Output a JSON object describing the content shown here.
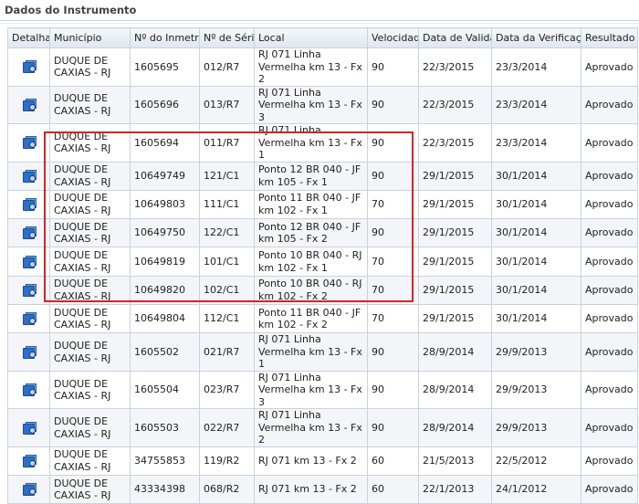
{
  "panel": {
    "title": "Dados do Instrumento"
  },
  "table": {
    "columns": [
      "Detalhar",
      "Município",
      "Nº do Inmetro",
      "Nº de Série",
      "Local",
      "Velocidade",
      "Data de Validade",
      "Data da Verificação",
      "Resultado"
    ],
    "rows": [
      {
        "municipio": "DUQUE DE CAXIAS - RJ",
        "inmetro": "1605695",
        "serie": "012/R7",
        "local": "RJ 071 Linha Vermelha km 13 - Fx 2",
        "velocidade": "90",
        "validade": "22/3/2015",
        "verificacao": "23/3/2014",
        "resultado": "Aprovado"
      },
      {
        "municipio": "DUQUE DE CAXIAS - RJ",
        "inmetro": "1605696",
        "serie": "013/R7",
        "local": "RJ 071 Linha Vermelha km 13 - Fx 3",
        "velocidade": "90",
        "validade": "22/3/2015",
        "verificacao": "23/3/2014",
        "resultado": "Aprovado"
      },
      {
        "municipio": "DUQUE DE CAXIAS - RJ",
        "inmetro": "1605694",
        "serie": "011/R7",
        "local": "RJ 071 Linha Vermelha km 13 - Fx 1",
        "velocidade": "90",
        "validade": "22/3/2015",
        "verificacao": "23/3/2014",
        "resultado": "Aprovado"
      },
      {
        "municipio": "DUQUE DE CAXIAS - RJ",
        "inmetro": "10649749",
        "serie": "121/C1",
        "local": "Ponto 12 BR 040 - JF km 105 - Fx 1",
        "velocidade": "90",
        "validade": "29/1/2015",
        "verificacao": "30/1/2014",
        "resultado": "Aprovado"
      },
      {
        "municipio": "DUQUE DE CAXIAS - RJ",
        "inmetro": "10649803",
        "serie": "111/C1",
        "local": "Ponto 11 BR 040 - JF km 102 - Fx 1",
        "velocidade": "70",
        "validade": "29/1/2015",
        "verificacao": "30/1/2014",
        "resultado": "Aprovado"
      },
      {
        "municipio": "DUQUE DE CAXIAS - RJ",
        "inmetro": "10649750",
        "serie": "122/C1",
        "local": "Ponto 12 BR 040 - JF km 105 - Fx 2",
        "velocidade": "90",
        "validade": "29/1/2015",
        "verificacao": "30/1/2014",
        "resultado": "Aprovado"
      },
      {
        "municipio": "DUQUE DE CAXIAS - RJ",
        "inmetro": "10649819",
        "serie": "101/C1",
        "local": "Ponto 10 BR 040 - RJ km 102 - Fx 1",
        "velocidade": "70",
        "validade": "29/1/2015",
        "verificacao": "30/1/2014",
        "resultado": "Aprovado"
      },
      {
        "municipio": "DUQUE DE CAXIAS - RJ",
        "inmetro": "10649820",
        "serie": "102/C1",
        "local": "Ponto 10 BR 040 - RJ km 102 - Fx 2",
        "velocidade": "70",
        "validade": "29/1/2015",
        "verificacao": "30/1/2014",
        "resultado": "Aprovado"
      },
      {
        "municipio": "DUQUE DE CAXIAS - RJ",
        "inmetro": "10649804",
        "serie": "112/C1",
        "local": "Ponto 11 BR 040 - JF km 102 - Fx 2",
        "velocidade": "70",
        "validade": "29/1/2015",
        "verificacao": "30/1/2014",
        "resultado": "Aprovado"
      },
      {
        "municipio": "DUQUE DE CAXIAS - RJ",
        "inmetro": "1605502",
        "serie": "021/R7",
        "local": "RJ 071 Linha Vermelha km 13 - Fx 1",
        "velocidade": "90",
        "validade": "28/9/2014",
        "verificacao": "29/9/2013",
        "resultado": "Aprovado"
      },
      {
        "municipio": "DUQUE DE CAXIAS - RJ",
        "inmetro": "1605504",
        "serie": "023/R7",
        "local": "RJ 071 Linha Vermelha km 13 - Fx 3",
        "velocidade": "90",
        "validade": "28/9/2014",
        "verificacao": "29/9/2013",
        "resultado": "Aprovado"
      },
      {
        "municipio": "DUQUE DE CAXIAS - RJ",
        "inmetro": "1605503",
        "serie": "022/R7",
        "local": "RJ 071 Linha Vermelha km 13 - Fx 2",
        "velocidade": "90",
        "validade": "28/9/2014",
        "verificacao": "29/9/2013",
        "resultado": "Aprovado"
      },
      {
        "municipio": "DUQUE DE CAXIAS - RJ",
        "inmetro": "34755853",
        "serie": "119/R2",
        "local": "RJ 071 km 13 - Fx 2",
        "velocidade": "60",
        "validade": "21/5/2013",
        "verificacao": "22/5/2012",
        "resultado": "Aprovado"
      },
      {
        "municipio": "DUQUE DE CAXIAS - RJ",
        "inmetro": "43334398",
        "serie": "068/R2",
        "local": "RJ 071 km 13 - Fx 2",
        "velocidade": "60",
        "validade": "22/1/2013",
        "verificacao": "24/1/2012",
        "resultado": "Aprovado"
      }
    ]
  },
  "icons": {
    "detail": "view-details-icon"
  },
  "colors": {
    "highlight_border": "#d0252c",
    "header_bg": "#e9eef4",
    "border": "#c9d3de"
  }
}
